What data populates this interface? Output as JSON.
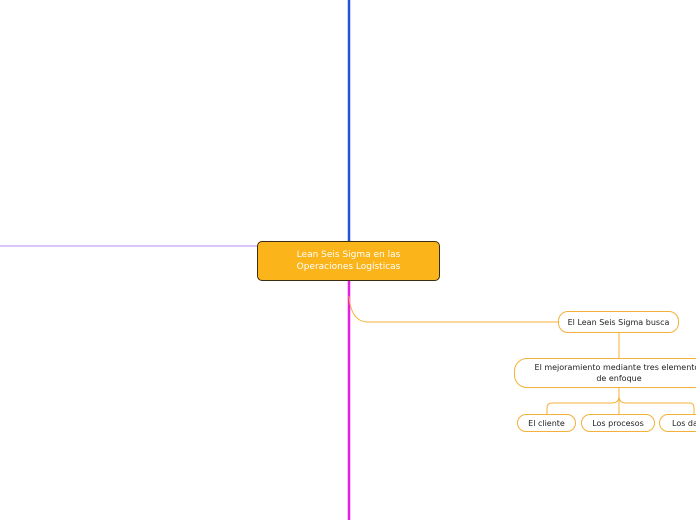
{
  "central": {
    "label": "Lean Seis Sigma en las Operaciones Logísticas"
  },
  "nodes": {
    "busca": "El Lean Seis Sigma busca",
    "mejoramiento": "El mejoramiento mediante tres elementos de enfoque",
    "cliente": "El cliente",
    "procesos": "Los procesos",
    "datos": "Los datos"
  },
  "colors": {
    "central_fill": "#fbb419",
    "central_border": "#3a2e12",
    "branch_top": "#2255dd",
    "branch_left": "#b48cf2",
    "branch_bottom": "#e81ee0",
    "node_border": "#f4b13a"
  }
}
